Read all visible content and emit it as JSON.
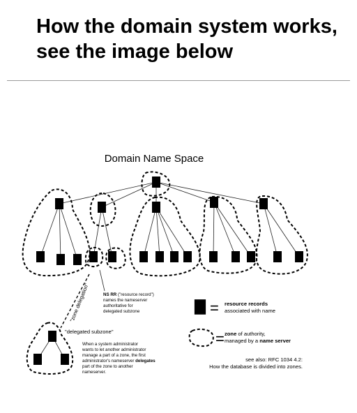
{
  "heading": {
    "line1": "How the domain system works,",
    "line2": "see the image below"
  },
  "diagram": {
    "title": "Domain Name Space",
    "ns_note": {
      "line1_bold": "NS RR",
      "line1_rest": " (\"resource record\")",
      "line2": "names the nameserver",
      "line3": "authoritative for",
      "line4": "delegated subzone"
    },
    "zone_delegation_label": "\"zone delegation\"",
    "delegated_subzone_label": "\"delegated subzone\"",
    "admin_note": {
      "line1": "When a system administrator",
      "line2": "wants to let another administrator",
      "line3": "manage a part of a zone, the first",
      "line4_plain": "administrator's nameserver ",
      "line4_bold": "delegates",
      "line5": "part of the zone to another",
      "line6": "nameserver."
    },
    "legend": {
      "records_symbol": "=",
      "records_title": "resource records",
      "records_sub": "associated with name",
      "zone_symbol": "=",
      "zone_title_bold": "zone",
      "zone_title_rest": " of authority,",
      "zone_sub_plain": "managed by a ",
      "zone_sub_bold": "name server"
    },
    "reference": {
      "line1": "see also: RFC 1034 4.2:",
      "line2": "How the database is divided into zones."
    }
  }
}
